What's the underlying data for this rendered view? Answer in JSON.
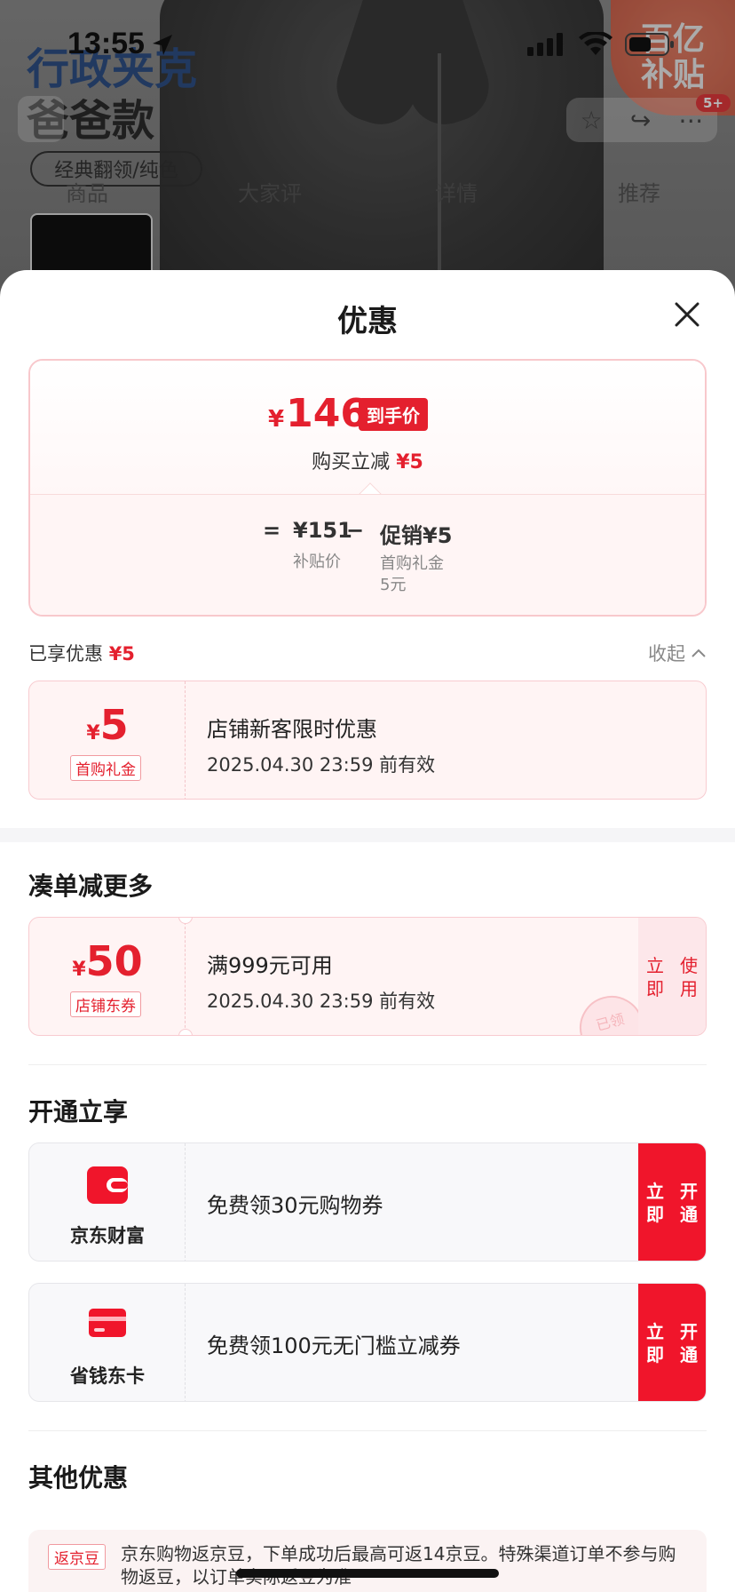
{
  "status_bar": {
    "time": "13:55"
  },
  "background": {
    "title_line1": "行政夹克",
    "title_line2": "爸爸款",
    "tag": "经典翻领/纯色",
    "tabs": [
      "商品",
      "大家评",
      "详情",
      "推荐"
    ],
    "badge_line1": "百亿",
    "badge_line2": "补贴",
    "cart_count": "5+"
  },
  "sheet": {
    "title": "优惠",
    "summary": {
      "currency": "¥",
      "final_price": "146",
      "final_price_tag": "到手价",
      "reduce_label": "购买立减",
      "reduce_value": "¥5",
      "equals": "=",
      "base_price": "¥151",
      "base_label": "补贴价",
      "minus": "−",
      "promo_label": "促销¥5",
      "promo_detail_line1": "首购礼金",
      "promo_detail_line2": "5元"
    },
    "enjoyed": {
      "label": "已享优惠",
      "value": "¥5",
      "collapse": "收起"
    },
    "enjoyed_coupon": {
      "currency": "¥",
      "amount": "5",
      "kind": "首购礼金",
      "title": "店铺新客限时优惠",
      "validity": "2025.04.30 23:59 前有效"
    },
    "more_section": {
      "title": "凑单减更多",
      "coupon": {
        "currency": "¥",
        "amount": "50",
        "kind": "店铺东券",
        "title": "满999元可用",
        "validity": "2025.04.30 23:59 前有效",
        "action": "立即使用",
        "stamp": "已领"
      }
    },
    "open_section": {
      "title": "开通立享",
      "items": [
        {
          "name": "京东财富",
          "desc": "免费领30元购物券",
          "action": "立即开通"
        },
        {
          "name": "省钱东卡",
          "desc": "免费领100元无门槛立减券",
          "action": "立即开通"
        }
      ]
    },
    "other_section": {
      "title": "其他优惠",
      "tag": "返京豆",
      "text": "京东购物返京豆，下单成功后最高可返14京豆。特殊渠道订单不参与购物返豆，以订单实际返豆为准"
    }
  },
  "colors": {
    "brand_red": "#e4202e",
    "action_red": "#f0152b"
  }
}
